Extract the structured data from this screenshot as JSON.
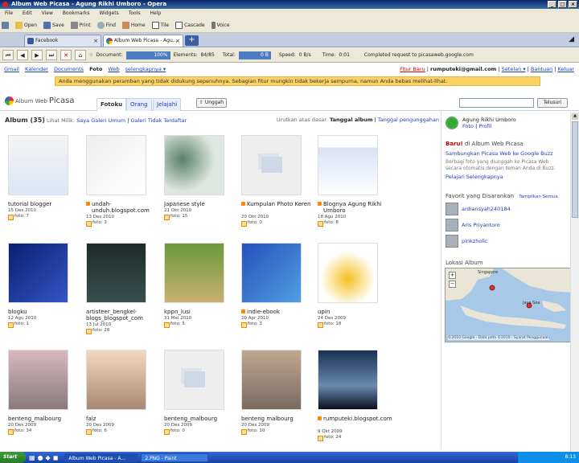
{
  "window": {
    "title": "Album Web Picasa - Agung Rikhi Umboro - Opera"
  },
  "menu": [
    "File",
    "Edit",
    "View",
    "Bookmarks",
    "Widgets",
    "Tools",
    "Help"
  ],
  "toolbar": [
    {
      "label": "Open",
      "icon": "folder-icon"
    },
    {
      "label": "Save",
      "icon": "disk-icon"
    },
    {
      "label": "Print",
      "icon": "printer-icon"
    },
    {
      "label": "Find",
      "icon": "magnifier-icon"
    },
    {
      "label": "Home",
      "icon": "house-icon"
    },
    {
      "label": "Tile",
      "icon": "tile-icon"
    },
    {
      "label": "Cascade",
      "icon": "cascade-icon"
    },
    {
      "label": "Voice",
      "icon": "microphone-icon"
    }
  ],
  "tabs": [
    {
      "label": "Facebook",
      "active": false
    },
    {
      "label": "Album Web Picasa - Agu...",
      "active": true
    }
  ],
  "newtab_label": "+",
  "status": {
    "document_label": "Document:",
    "document_value": "100%",
    "elements_label": "Elements:",
    "elements_value": "84/85",
    "total_label": "Total:",
    "total_value": "0 B",
    "speed_label": "Speed:",
    "speed_value": "0 B/s",
    "time_label": "Time:",
    "time_value": "0:01",
    "message": "Completed request to picasaweb.google.com"
  },
  "gbar": {
    "links": [
      "Gmail",
      "Kalender",
      "Documents",
      "Foto",
      "Web",
      "selengkapnya ▾"
    ],
    "right_new": "Fitur Baru",
    "right_user": "rumputeki@gmail.com",
    "right_links": [
      "Setelan ▾",
      "Bantuan",
      "Keluar"
    ]
  },
  "notice": "Anda menggunakan peramban yang tidak didukung sepenuhnya. Sebagian fitur mungkin tidak bekerja sempurna, namun Anda bebas melihat-lihat.",
  "header": {
    "logo_small": "Album Web",
    "logo_big": "Picasa",
    "tabs": [
      {
        "label": "Fotoku",
        "active": true
      },
      {
        "label": "Orang",
        "active": false
      },
      {
        "label": "Jelajahi",
        "active": false
      }
    ],
    "upload": "Unggah",
    "search_button": "Telusuri"
  },
  "albums_header": {
    "title": "Album (35)",
    "prefix": "Lihat Milik:",
    "link_public": "Saya Galeri Umum",
    "sep": "|",
    "link_unlisted": "Galeri Tidak Terdaftar",
    "sort_label": "Urutkan atas dasar:",
    "sort_active": "Tanggal album",
    "sort_other": "Tanggal pengunggahan"
  },
  "albums": [
    {
      "name": "tutorial blogger",
      "date": "15 Des 2010",
      "count": "foto: 7",
      "rss": false
    },
    {
      "name": "undah-unduh.blogspot.com",
      "date": "13 Des 2010",
      "count": "foto: 3",
      "rss": true
    },
    {
      "name": "Japanese style",
      "date": "21 Okt 2010",
      "count": "foto: 15",
      "rss": false
    },
    {
      "name": "Kumpulan Photo Keren",
      "date": "20 Okt 2010",
      "count": "foto: 0",
      "rss": true
    },
    {
      "name": "Blognya Agung Rikhi Umboro",
      "date": "18 Agu 2010",
      "count": "foto: 8",
      "rss": true
    },
    {
      "name": "blogku",
      "date": "12 Agu 2010",
      "count": "foto: 1",
      "rss": false
    },
    {
      "name": "artisteer_bengkel-blogs_blogspot_com",
      "date": "13 Jul 2010",
      "count": "foto: 28",
      "rss": false
    },
    {
      "name": "kppn_lusi",
      "date": "31 Mei 2010",
      "count": "foto: 5",
      "rss": false
    },
    {
      "name": "indie-ebook",
      "date": "20 Apr 2010",
      "count": "foto: 3",
      "rss": true
    },
    {
      "name": "upin",
      "date": "24 Des 2009",
      "count": "foto: 18",
      "rss": false
    },
    {
      "name": "benteng_malbourg",
      "date": "20 Des 2009",
      "count": "foto: 34",
      "rss": false
    },
    {
      "name": "faiz",
      "date": "20 Des 2009",
      "count": "foto: 6",
      "rss": false
    },
    {
      "name": "benteng_malbourg",
      "date": "20 Des 2009",
      "count": "foto: 0",
      "rss": false
    },
    {
      "name": "benteng malbourg",
      "date": "20 Des 2009",
      "count": "foto: 10",
      "rss": false
    },
    {
      "name": "rumputeki.blogspot.com",
      "date": "9 Okt 2009",
      "count": "foto: 24",
      "rss": true
    }
  ],
  "sidebar": {
    "user_name": "Agung Rikhi Umboro",
    "user_link1": "Foto",
    "user_link2": "Profil",
    "new_label": "Baru!",
    "new_text": "di Album Web Picasa",
    "new_link": "Sambungkan Picasa Web ke Google Buzz",
    "new_desc": "Berbagi foto yang diunggah ke Picasa Web secara otomatis dengan teman Anda di Buzz.",
    "new_more": "Pelajari Selengkapnya",
    "fav_title": "Favorit yang Disarankan",
    "fav_all": "Tampilkan Semua",
    "favorites": [
      "ardiansyah240184",
      "Aris Priyantoro",
      "pinkzholic"
    ],
    "location_title": "Lokasi Album",
    "map_labels": {
      "singapore": "Singapore",
      "sea": "Java Sea"
    },
    "map_footer": "©2010 Google - Data peta ©2010 - Syarat Penggunaan"
  },
  "taskbar": {
    "start": "Start",
    "tasks": [
      {
        "label": "Album Web Picasa - A...",
        "active": true
      },
      {
        "label": "2.PNG - Paint",
        "active": false
      }
    ],
    "clock": "8:13"
  }
}
